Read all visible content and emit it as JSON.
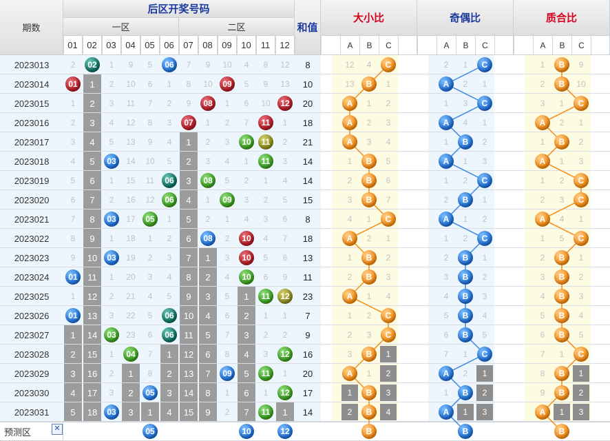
{
  "header": {
    "period_label": "期数",
    "back_zone_title": "后区开奖号码",
    "zone1_label": "一区",
    "zone2_label": "二区",
    "sum_label": "和值",
    "size_title": "大小比",
    "parity_title": "奇偶比",
    "prime_title": "质合比",
    "number_headers": [
      "01",
      "02",
      "03",
      "04",
      "05",
      "06",
      "07",
      "08",
      "09",
      "10",
      "11",
      "12"
    ],
    "abc": [
      "A",
      "B",
      "C"
    ],
    "predict_label": "预测区"
  },
  "colors": {
    "title_red": "#d6001c",
    "title_blue": "#1a3a9e",
    "header_bg": "#e8e8e8",
    "row_light_blue": "#eef6fd",
    "ratio_yellow": "#fefbe3",
    "missing_gray": "#9c9c9c",
    "ball_orange": "#f58a12",
    "ball_blue": "#1f6fd6"
  },
  "rows": [
    {
      "period": "2023013",
      "nums": [
        {
          "t": "2"
        },
        {
          "t": "02",
          "b": "teal"
        },
        {
          "t": "1"
        },
        {
          "t": "9"
        },
        {
          "t": "5"
        },
        {
          "t": "06",
          "b": "blue"
        },
        {
          "t": "7"
        },
        {
          "t": "9"
        },
        {
          "t": "10"
        },
        {
          "t": "4"
        },
        {
          "t": "8"
        },
        {
          "t": "12"
        }
      ],
      "sum": "8",
      "size": [
        "12",
        "4",
        "C"
      ],
      "sizeSel": 2,
      "parity": [
        "2",
        "1",
        "C"
      ],
      "paritySel": 2,
      "prime": [
        "1",
        "B",
        "9"
      ],
      "primeSel": 1
    },
    {
      "period": "2023014",
      "nums": [
        {
          "t": "01",
          "b": "red"
        },
        {
          "t": "1",
          "g": 1
        },
        {
          "t": "2"
        },
        {
          "t": "10"
        },
        {
          "t": "6"
        },
        {
          "t": "1"
        },
        {
          "t": "8"
        },
        {
          "t": "10"
        },
        {
          "t": "09",
          "b": "red"
        },
        {
          "t": "5"
        },
        {
          "t": "9"
        },
        {
          "t": "13"
        }
      ],
      "sum": "10",
      "size": [
        "13",
        "B",
        "1"
      ],
      "sizeSel": 1,
      "parity": [
        "A",
        "2",
        "1"
      ],
      "paritySel": 0,
      "prime": [
        "2",
        "B",
        "10"
      ],
      "primeSel": 1
    },
    {
      "period": "2023015",
      "nums": [
        {
          "t": "1"
        },
        {
          "t": "2",
          "g": 1
        },
        {
          "t": "3"
        },
        {
          "t": "11"
        },
        {
          "t": "7"
        },
        {
          "t": "2"
        },
        {
          "t": "9"
        },
        {
          "t": "08",
          "b": "red"
        },
        {
          "t": "1"
        },
        {
          "t": "6"
        },
        {
          "t": "10"
        },
        {
          "t": "12",
          "b": "red"
        }
      ],
      "sum": "20",
      "size": [
        "A",
        "1",
        "2"
      ],
      "sizeSel": 0,
      "parity": [
        "1",
        "3",
        "C"
      ],
      "paritySel": 2,
      "prime": [
        "3",
        "1",
        "C"
      ],
      "primeSel": 2
    },
    {
      "period": "2023016",
      "nums": [
        {
          "t": "2"
        },
        {
          "t": "3",
          "g": 1
        },
        {
          "t": "4"
        },
        {
          "t": "12"
        },
        {
          "t": "8"
        },
        {
          "t": "3"
        },
        {
          "t": "07",
          "b": "red"
        },
        {
          "t": "1"
        },
        {
          "t": "2"
        },
        {
          "t": "7"
        },
        {
          "t": "11",
          "b": "red"
        },
        {
          "t": "1"
        }
      ],
      "sum": "18",
      "size": [
        "A",
        "2",
        "3"
      ],
      "sizeSel": 0,
      "parity": [
        "A",
        "4",
        "1"
      ],
      "paritySel": 0,
      "prime": [
        "A",
        "2",
        "1"
      ],
      "primeSel": 0
    },
    {
      "period": "2023017",
      "nums": [
        {
          "t": "3"
        },
        {
          "t": "4",
          "g": 1
        },
        {
          "t": "5"
        },
        {
          "t": "13"
        },
        {
          "t": "9"
        },
        {
          "t": "4"
        },
        {
          "t": "1",
          "g": 1
        },
        {
          "t": "2"
        },
        {
          "t": "3"
        },
        {
          "t": "10",
          "b": "green"
        },
        {
          "t": "11",
          "b": "olive"
        },
        {
          "t": "2"
        }
      ],
      "sum": "21",
      "size": [
        "A",
        "3",
        "4"
      ],
      "sizeSel": 0,
      "parity": [
        "1",
        "B",
        "2"
      ],
      "paritySel": 1,
      "prime": [
        "1",
        "B",
        "2"
      ],
      "primeSel": 1
    },
    {
      "period": "2023018",
      "nums": [
        {
          "t": "4"
        },
        {
          "t": "5",
          "g": 1
        },
        {
          "t": "03",
          "b": "blue"
        },
        {
          "t": "14"
        },
        {
          "t": "10"
        },
        {
          "t": "5"
        },
        {
          "t": "2",
          "g": 1
        },
        {
          "t": "3"
        },
        {
          "t": "4"
        },
        {
          "t": "1"
        },
        {
          "t": "11",
          "b": "green"
        },
        {
          "t": "3"
        }
      ],
      "sum": "14",
      "size": [
        "1",
        "B",
        "5"
      ],
      "sizeSel": 1,
      "parity": [
        "A",
        "1",
        "3"
      ],
      "paritySel": 0,
      "prime": [
        "A",
        "1",
        "3"
      ],
      "primeSel": 0
    },
    {
      "period": "2023019",
      "nums": [
        {
          "t": "5"
        },
        {
          "t": "6",
          "g": 1
        },
        {
          "t": "1"
        },
        {
          "t": "15"
        },
        {
          "t": "11"
        },
        {
          "t": "06",
          "b": "teal"
        },
        {
          "t": "3",
          "g": 1
        },
        {
          "t": "08",
          "b": "green"
        },
        {
          "t": "5"
        },
        {
          "t": "2"
        },
        {
          "t": "1"
        },
        {
          "t": "4"
        }
      ],
      "sum": "14",
      "size": [
        "2",
        "B",
        "6"
      ],
      "sizeSel": 1,
      "parity": [
        "1",
        "2",
        "C"
      ],
      "paritySel": 2,
      "prime": [
        "1",
        "2",
        "C"
      ],
      "primeSel": 2
    },
    {
      "period": "2023020",
      "nums": [
        {
          "t": "6"
        },
        {
          "t": "7",
          "g": 1
        },
        {
          "t": "2"
        },
        {
          "t": "16"
        },
        {
          "t": "12"
        },
        {
          "t": "06",
          "b": "green"
        },
        {
          "t": "4",
          "g": 1
        },
        {
          "t": "1"
        },
        {
          "t": "09",
          "b": "green"
        },
        {
          "t": "3"
        },
        {
          "t": "2"
        },
        {
          "t": "5"
        }
      ],
      "sum": "15",
      "size": [
        "3",
        "B",
        "7"
      ],
      "sizeSel": 1,
      "parity": [
        "2",
        "B",
        "1"
      ],
      "paritySel": 1,
      "prime": [
        "2",
        "3",
        "C"
      ],
      "primeSel": 2
    },
    {
      "period": "2023021",
      "nums": [
        {
          "t": "7"
        },
        {
          "t": "8",
          "g": 1
        },
        {
          "t": "03",
          "b": "blue"
        },
        {
          "t": "17"
        },
        {
          "t": "05",
          "b": "green"
        },
        {
          "t": "1"
        },
        {
          "t": "5",
          "g": 1
        },
        {
          "t": "2"
        },
        {
          "t": "1"
        },
        {
          "t": "4"
        },
        {
          "t": "3"
        },
        {
          "t": "6"
        }
      ],
      "sum": "8",
      "size": [
        "4",
        "1",
        "C"
      ],
      "sizeSel": 2,
      "parity": [
        "A",
        "1",
        "2"
      ],
      "paritySel": 0,
      "prime": [
        "A",
        "4",
        "1"
      ],
      "primeSel": 0
    },
    {
      "period": "2023022",
      "nums": [
        {
          "t": "8"
        },
        {
          "t": "9",
          "g": 1
        },
        {
          "t": "1"
        },
        {
          "t": "18"
        },
        {
          "t": "1"
        },
        {
          "t": "2"
        },
        {
          "t": "6",
          "g": 1
        },
        {
          "t": "08",
          "b": "blue"
        },
        {
          "t": "2"
        },
        {
          "t": "10",
          "b": "red"
        },
        {
          "t": "4"
        },
        {
          "t": "7"
        }
      ],
      "sum": "18",
      "size": [
        "A",
        "2",
        "1"
      ],
      "sizeSel": 0,
      "parity": [
        "1",
        "2",
        "C"
      ],
      "paritySel": 2,
      "prime": [
        "1",
        "5",
        "C"
      ],
      "primeSel": 2
    },
    {
      "period": "2023023",
      "nums": [
        {
          "t": "9"
        },
        {
          "t": "10",
          "g": 1
        },
        {
          "t": "03",
          "b": "blue"
        },
        {
          "t": "19"
        },
        {
          "t": "2"
        },
        {
          "t": "3"
        },
        {
          "t": "7",
          "g": 1
        },
        {
          "t": "1",
          "g": 1
        },
        {
          "t": "3"
        },
        {
          "t": "10",
          "b": "red"
        },
        {
          "t": "5"
        },
        {
          "t": "8"
        }
      ],
      "sum": "13",
      "size": [
        "1",
        "B",
        "2"
      ],
      "sizeSel": 1,
      "parity": [
        "2",
        "B",
        "1"
      ],
      "paritySel": 1,
      "prime": [
        "2",
        "B",
        "1"
      ],
      "primeSel": 1
    },
    {
      "period": "2023024",
      "nums": [
        {
          "t": "01",
          "b": "blue"
        },
        {
          "t": "11",
          "g": 1
        },
        {
          "t": "1"
        },
        {
          "t": "20"
        },
        {
          "t": "3"
        },
        {
          "t": "4"
        },
        {
          "t": "8",
          "g": 1
        },
        {
          "t": "2",
          "g": 1
        },
        {
          "t": "4"
        },
        {
          "t": "10",
          "b": "green"
        },
        {
          "t": "6"
        },
        {
          "t": "9"
        }
      ],
      "sum": "11",
      "size": [
        "2",
        "B",
        "3"
      ],
      "sizeSel": 1,
      "parity": [
        "3",
        "B",
        "2"
      ],
      "paritySel": 1,
      "prime": [
        "3",
        "B",
        "2"
      ],
      "primeSel": 1
    },
    {
      "period": "2023025",
      "nums": [
        {
          "t": "1"
        },
        {
          "t": "12",
          "g": 1
        },
        {
          "t": "2"
        },
        {
          "t": "21"
        },
        {
          "t": "4"
        },
        {
          "t": "5"
        },
        {
          "t": "9",
          "g": 1
        },
        {
          "t": "3",
          "g": 1
        },
        {
          "t": "5"
        },
        {
          "t": "1",
          "g": 1
        },
        {
          "t": "11",
          "b": "green"
        },
        {
          "t": "12",
          "b": "olive"
        }
      ],
      "sum": "23",
      "size": [
        "A",
        "1",
        "4"
      ],
      "sizeSel": 0,
      "parity": [
        "4",
        "B",
        "3"
      ],
      "paritySel": 1,
      "prime": [
        "4",
        "B",
        "3"
      ],
      "primeSel": 1
    },
    {
      "period": "2023026",
      "nums": [
        {
          "t": "01",
          "b": "blue"
        },
        {
          "t": "13",
          "g": 1
        },
        {
          "t": "3"
        },
        {
          "t": "22"
        },
        {
          "t": "5"
        },
        {
          "t": "06",
          "b": "teal"
        },
        {
          "t": "10",
          "g": 1
        },
        {
          "t": "4",
          "g": 1
        },
        {
          "t": "6"
        },
        {
          "t": "2",
          "g": 1
        },
        {
          "t": "1"
        },
        {
          "t": "1"
        }
      ],
      "sum": "7",
      "size": [
        "1",
        "2",
        "C"
      ],
      "sizeSel": 2,
      "parity": [
        "5",
        "B",
        "4"
      ],
      "paritySel": 1,
      "prime": [
        "5",
        "B",
        "4"
      ],
      "primeSel": 1
    },
    {
      "period": "2023027",
      "nums": [
        {
          "t": "1",
          "g": 1
        },
        {
          "t": "14",
          "g": 1
        },
        {
          "t": "03",
          "b": "green"
        },
        {
          "t": "23"
        },
        {
          "t": "6"
        },
        {
          "t": "06",
          "b": "teal"
        },
        {
          "t": "11",
          "g": 1
        },
        {
          "t": "5",
          "g": 1
        },
        {
          "t": "7"
        },
        {
          "t": "3",
          "g": 1
        },
        {
          "t": "2"
        },
        {
          "t": "2"
        }
      ],
      "sum": "9",
      "size": [
        "2",
        "3",
        "C"
      ],
      "sizeSel": 2,
      "parity": [
        "6",
        "B",
        "5"
      ],
      "paritySel": 1,
      "prime": [
        "6",
        "B",
        "5"
      ],
      "primeSel": 1
    },
    {
      "period": "2023028",
      "nums": [
        {
          "t": "2",
          "g": 1
        },
        {
          "t": "15",
          "g": 1
        },
        {
          "t": "1"
        },
        {
          "t": "04",
          "b": "green"
        },
        {
          "t": "7"
        },
        {
          "t": "1",
          "g": 1
        },
        {
          "t": "12",
          "g": 1
        },
        {
          "t": "6",
          "g": 1
        },
        {
          "t": "8"
        },
        {
          "t": "4",
          "g": 1
        },
        {
          "t": "3"
        },
        {
          "t": "12",
          "b": "green"
        }
      ],
      "sum": "16",
      "size": [
        "3",
        "B",
        "1"
      ],
      "sizeSel": 1,
      "sizeGray": [
        2
      ],
      "parity": [
        "7",
        "1",
        "C"
      ],
      "paritySel": 2,
      "prime": [
        "7",
        "1",
        "C"
      ],
      "primeSel": 2
    },
    {
      "period": "2023029",
      "nums": [
        {
          "t": "3",
          "g": 1
        },
        {
          "t": "16",
          "g": 1
        },
        {
          "t": "2"
        },
        {
          "t": "1",
          "g": 1
        },
        {
          "t": "8"
        },
        {
          "t": "2",
          "g": 1
        },
        {
          "t": "13",
          "g": 1
        },
        {
          "t": "7",
          "g": 1
        },
        {
          "t": "09",
          "b": "blue"
        },
        {
          "t": "5",
          "g": 1
        },
        {
          "t": "11",
          "b": "green"
        },
        {
          "t": "1"
        }
      ],
      "sum": "20",
      "size": [
        "A",
        "1",
        "2"
      ],
      "sizeSel": 0,
      "sizeGray": [
        2
      ],
      "parity": [
        "A",
        "2",
        "1"
      ],
      "paritySel": 0,
      "parityGray": [
        2
      ],
      "prime": [
        "8",
        "B",
        "1"
      ],
      "primeSel": 1,
      "primeGray": [
        2
      ]
    },
    {
      "period": "2023030",
      "nums": [
        {
          "t": "4",
          "g": 1
        },
        {
          "t": "17",
          "g": 1
        },
        {
          "t": "3"
        },
        {
          "t": "2",
          "g": 1
        },
        {
          "t": "05",
          "b": "blue"
        },
        {
          "t": "3",
          "g": 1
        },
        {
          "t": "14",
          "g": 1
        },
        {
          "t": "8",
          "g": 1
        },
        {
          "t": "1"
        },
        {
          "t": "6",
          "g": 1
        },
        {
          "t": "1"
        },
        {
          "t": "12",
          "b": "green"
        }
      ],
      "sum": "17",
      "size": [
        "1",
        "B",
        "3"
      ],
      "sizeSel": 1,
      "sizeGray": [
        0,
        2
      ],
      "parity": [
        "1",
        "B",
        "2"
      ],
      "paritySel": 1,
      "parityGray": [
        2
      ],
      "prime": [
        "9",
        "B",
        "2"
      ],
      "primeSel": 1,
      "primeGray": [
        2
      ]
    },
    {
      "period": "2023031",
      "nums": [
        {
          "t": "5",
          "g": 1
        },
        {
          "t": "18",
          "g": 1
        },
        {
          "t": "03",
          "b": "blue"
        },
        {
          "t": "3",
          "g": 1
        },
        {
          "t": "1",
          "g": 1
        },
        {
          "t": "4",
          "g": 1
        },
        {
          "t": "15",
          "g": 1
        },
        {
          "t": "9",
          "g": 1
        },
        {
          "t": "2"
        },
        {
          "t": "7",
          "g": 1
        },
        {
          "t": "11",
          "b": "green"
        },
        {
          "t": "1",
          "g": 1
        }
      ],
      "sum": "14",
      "size": [
        "2",
        "B",
        "4"
      ],
      "sizeSel": 1,
      "sizeGray": [
        0,
        2
      ],
      "parity": [
        "A",
        "1",
        "3"
      ],
      "paritySel": 0,
      "parityGray": [
        1,
        2
      ],
      "prime": [
        "A",
        "1",
        "3"
      ],
      "primeSel": 0,
      "primeGray": [
        1,
        2
      ]
    }
  ],
  "prediction": {
    "balls": [
      {
        "col": 4,
        "t": "05"
      },
      {
        "col": 9,
        "t": "10"
      },
      {
        "col": 11,
        "t": "12"
      }
    ],
    "size": "B",
    "parity": "B",
    "prime": "B"
  }
}
